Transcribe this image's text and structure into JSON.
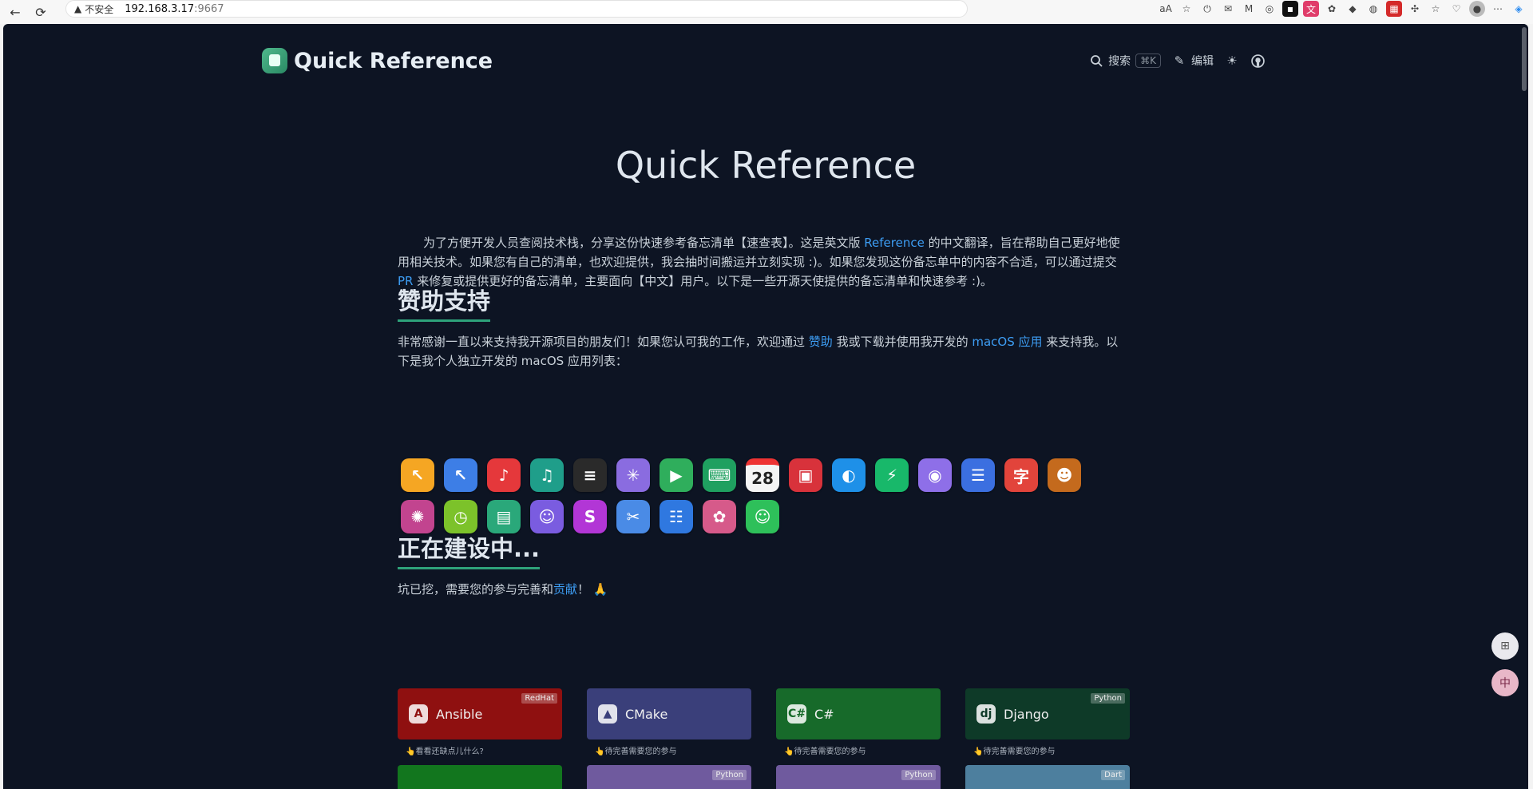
{
  "browser": {
    "back_icon": "←",
    "reload_icon": "⟳",
    "warn_icon": "▲",
    "insecure_label": "不安全",
    "host": "192.168.3.17",
    "port": ":9667"
  },
  "header": {
    "brand": "Quick Reference",
    "search_label": "搜索",
    "search_shortcut": "⌘K",
    "edit_label": "编辑"
  },
  "hero": {
    "title": "Quick Reference",
    "intro_part1": "为了方便开发人员查阅技术栈，分享这份快速参考备忘清单【速查表】。这是英文版 ",
    "intro_link1": "Reference",
    "intro_part2": " 的中文翻译，旨在帮助自己更好地使用相关技术。如果您有自己的清单，也欢迎提供，我会抽时间搬运并立刻实现 :)。如果您发现这份备忘单中的内容不合适，可以通过提交 ",
    "intro_link2": "PR",
    "intro_part3": " 来修复或提供更好的备忘清单，主要面向【中文】用户。以下是一些开源天使提供的备忘清单和快速参考 :)。"
  },
  "sponsor": {
    "title": "赞助支持",
    "text_part1": "非常感谢一直以来支持我开源项目的朋友们！如果您认可我的工作，欢迎通过 ",
    "link1": "赞助",
    "text_part2": " 我或下载并使用我开发的 ",
    "link2": "macOS 应用",
    "text_part3": " 来支持我。以下是我个人独立开发的 macOS 应用列表："
  },
  "apps": [
    {
      "name": "app-cursor-yellow",
      "glyph": "↖",
      "color": "#f5a623"
    },
    {
      "name": "app-cursor-blue",
      "glyph": "↖",
      "color": "#3d7ee6"
    },
    {
      "name": "app-music-red",
      "glyph": "♪",
      "color": "#e5383b"
    },
    {
      "name": "app-music-teal",
      "glyph": "♫",
      "color": "#1f9e8a"
    },
    {
      "name": "app-terminal",
      "glyph": "≡",
      "color": "#2a2a2a"
    },
    {
      "name": "app-click-purple",
      "glyph": "✳",
      "color": "#8a6ce0"
    },
    {
      "name": "app-play-green",
      "glyph": "▶",
      "color": "#2fae5c"
    },
    {
      "name": "app-keyboard-green",
      "glyph": "⌨",
      "color": "#1fa060"
    },
    {
      "name": "app-calendar",
      "glyph": "28",
      "color": "#f4f4f4"
    },
    {
      "name": "app-photo-red",
      "glyph": "▣",
      "color": "#d8323b"
    },
    {
      "name": "app-edge",
      "glyph": "◐",
      "color": "#1e90e8"
    },
    {
      "name": "app-battery-green",
      "glyph": "⚡",
      "color": "#18b86a"
    },
    {
      "name": "app-rss-purple",
      "glyph": "◉",
      "color": "#8e6fe8"
    },
    {
      "name": "app-list-blue",
      "glyph": "☰",
      "color": "#3b6fe0"
    },
    {
      "name": "app-font-red",
      "glyph": "字",
      "color": "#e2443b"
    },
    {
      "name": "app-monster",
      "glyph": "☻",
      "color": "#c46a1d"
    },
    {
      "name": "app-colorful",
      "glyph": "✺",
      "color": "#c2448f"
    },
    {
      "name": "app-clock-green",
      "glyph": "◷",
      "color": "#7cc22a"
    },
    {
      "name": "app-window-green",
      "glyph": "▤",
      "color": "#2aa87a"
    },
    {
      "name": "app-contact-purple",
      "glyph": "☺",
      "color": "#7a5ce0"
    },
    {
      "name": "app-s-purple",
      "glyph": "S",
      "color": "#b236d6"
    },
    {
      "name": "app-tools-blue",
      "glyph": "✂",
      "color": "#4a8be6"
    },
    {
      "name": "app-doc-blue",
      "glyph": "☷",
      "color": "#2f78e0"
    },
    {
      "name": "app-palette",
      "glyph": "✿",
      "color": "#d65a8a"
    },
    {
      "name": "app-smile-green",
      "glyph": "☺",
      "color": "#2ec05a"
    }
  ],
  "building": {
    "title": "正在建设中...",
    "text_part1": "坑已挖，需要您的参与完善和",
    "link": "贡献",
    "text_part2": "！ 🙏"
  },
  "cards": [
    {
      "label": "Ansible",
      "tag": "RedHat",
      "icon": "A",
      "color": "#8f1010",
      "note": "👆看看还缺点儿什么?"
    },
    {
      "label": "CMake",
      "tag": "",
      "icon": "▲",
      "color": "#3a3f7a",
      "note": "👆待完善需要您的参与"
    },
    {
      "label": "C#",
      "tag": "",
      "icon": "C#",
      "color": "#176a2a",
      "note": "👆待完善需要您的参与"
    },
    {
      "label": "Django",
      "tag": "Python",
      "icon": "dj",
      "color": "#0e3a28",
      "note": "👆待完善需要您的参与"
    },
    {
      "label": "",
      "tag": "",
      "icon": "",
      "color": "#12761e",
      "note": ""
    },
    {
      "label": "",
      "tag": "Python",
      "icon": "",
      "color": "#6f5a9e",
      "note": ""
    },
    {
      "label": "",
      "tag": "Python",
      "icon": "",
      "color": "#6f5a9e",
      "note": ""
    },
    {
      "label": "",
      "tag": "Dart",
      "icon": "",
      "color": "#4d7f9e",
      "note": ""
    }
  ],
  "colors": {
    "page_bg": "#0d1423",
    "accent": "#2ea27a",
    "link": "#3d9df3"
  }
}
